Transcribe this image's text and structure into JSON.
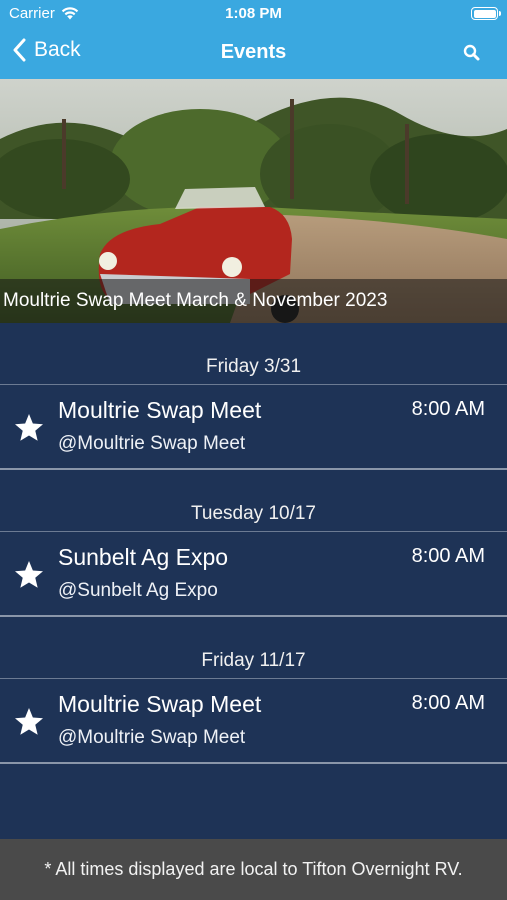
{
  "status_bar": {
    "carrier": "Carrier",
    "time": "1:08 PM"
  },
  "nav": {
    "back_label": "Back",
    "title": "Events"
  },
  "hero": {
    "caption": "Moultrie Swap Meet March & November 2023"
  },
  "events": [
    {
      "date": "Friday 3/31",
      "name": "Moultrie Swap Meet",
      "venue": "@Moultrie Swap Meet",
      "time": "8:00 AM"
    },
    {
      "date": "Tuesday 10/17",
      "name": "Sunbelt Ag Expo",
      "venue": "@Sunbelt Ag Expo",
      "time": "8:00 AM"
    },
    {
      "date": "Friday 11/17",
      "name": "Moultrie Swap Meet",
      "venue": "@Moultrie Swap Meet",
      "time": "8:00 AM"
    }
  ],
  "footer": {
    "note": "* All times displayed are local to Tifton Overnight RV."
  },
  "colors": {
    "nav_bar": "#3aa8e0",
    "list_background": "#1e3356",
    "footer": "#4a4a4a",
    "text": "#ffffff"
  }
}
